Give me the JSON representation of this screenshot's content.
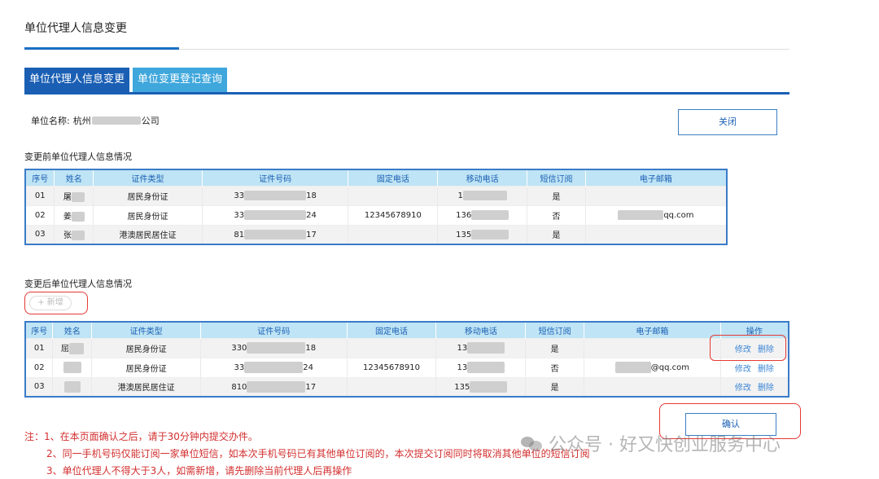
{
  "page": {
    "title": "单位代理人信息变更"
  },
  "tabs": [
    {
      "label": "单位代理人信息变更",
      "active": true
    },
    {
      "label": "单位变更登记查询",
      "active": false
    }
  ],
  "org": {
    "label": "单位名称:",
    "name_prefix": "杭州",
    "name_suffix": "公司"
  },
  "close_label": "关闭",
  "before": {
    "title": "变更前单位代理人信息情况",
    "headers": [
      "序号",
      "姓名",
      "证件类型",
      "证件号码",
      "固定电话",
      "移动电话",
      "短信订阅",
      "电子邮箱"
    ],
    "rows": [
      {
        "no": "01",
        "name": "屠",
        "id_type": "居民身份证",
        "id_head": "33",
        "id_tail": "18",
        "phone": "",
        "mobile_head": "1",
        "mobile_tail": "",
        "sms": "是",
        "email_tail": ""
      },
      {
        "no": "02",
        "name": "姜",
        "id_type": "居民身份证",
        "id_head": "33",
        "id_tail": "24",
        "phone": "12345678910",
        "mobile_head": "136",
        "mobile_tail": "",
        "sms": "否",
        "email_tail": "qq.com"
      },
      {
        "no": "03",
        "name": "张",
        "id_type": "港澳居民居住证",
        "id_head": "81",
        "id_tail": "17",
        "phone": "",
        "mobile_head": "135",
        "mobile_tail": "",
        "sms": "是",
        "email_tail": ""
      }
    ]
  },
  "after": {
    "title": "变更后单位代理人信息情况",
    "add_label": "+ 新增",
    "headers": [
      "序号",
      "姓名",
      "证件类型",
      "证件号码",
      "固定电话",
      "移动电话",
      "短信订阅",
      "电子邮箱",
      "操作"
    ],
    "rows": [
      {
        "no": "01",
        "name": "屈",
        "id_type": "居民身份证",
        "id_head": "330",
        "id_tail": "18",
        "phone": "",
        "mobile_head": "13",
        "sms": "是",
        "email_tail": "",
        "edit": "修改",
        "del": "删除"
      },
      {
        "no": "02",
        "name": "",
        "id_type": "居民身份证",
        "id_head": "33",
        "id_tail": "24",
        "phone": "12345678910",
        "mobile_head": "13",
        "sms": "否",
        "email_tail": "@qq.com",
        "edit": "修改",
        "del": "删除"
      },
      {
        "no": "03",
        "name": "",
        "id_type": "港澳居民居住证",
        "id_head": "810",
        "id_tail": "17",
        "phone": "",
        "mobile_head": "135",
        "sms": "是",
        "email_tail": "",
        "edit": "修改",
        "del": "删除"
      }
    ]
  },
  "confirm_label": "确认",
  "notes": [
    "注：1、在本页面确认之后，请于30分钟内提交办件。",
    "2、同一手机号码仅能订阅一家单位短信，如本次手机号码已有其他单位订阅的，本次提交订阅同时将取消其他单位的短信订阅",
    "3、单位代理人不得大于3人，如需新增，请先删除当前代理人后再操作"
  ],
  "watermark": "公众号 · 好又快创业服务中心",
  "colors": {
    "primary": "#1a5fb4",
    "tab_inactive": "#3fa7dc",
    "header_bg": "#bfe4f5",
    "highlight": "#e53935",
    "note": "#d32f2f"
  }
}
